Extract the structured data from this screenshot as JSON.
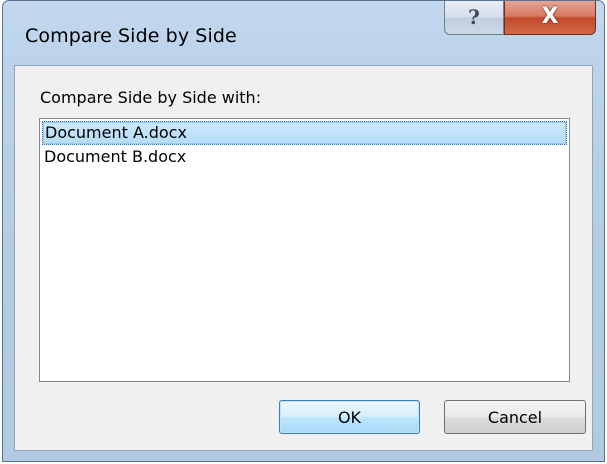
{
  "window": {
    "title": "Compare Side by Side",
    "help_glyph": "?",
    "close_glyph": "X"
  },
  "dialog": {
    "list_label": "Compare Side by Side with:",
    "items": [
      {
        "label": "Document A.docx",
        "selected": true
      },
      {
        "label": "Document B.docx",
        "selected": false
      }
    ],
    "ok_label": "OK",
    "cancel_label": "Cancel"
  },
  "colors": {
    "close_button": "#c24a2c",
    "selection": "#b4dcf8",
    "frame": "#bcd3eb"
  }
}
